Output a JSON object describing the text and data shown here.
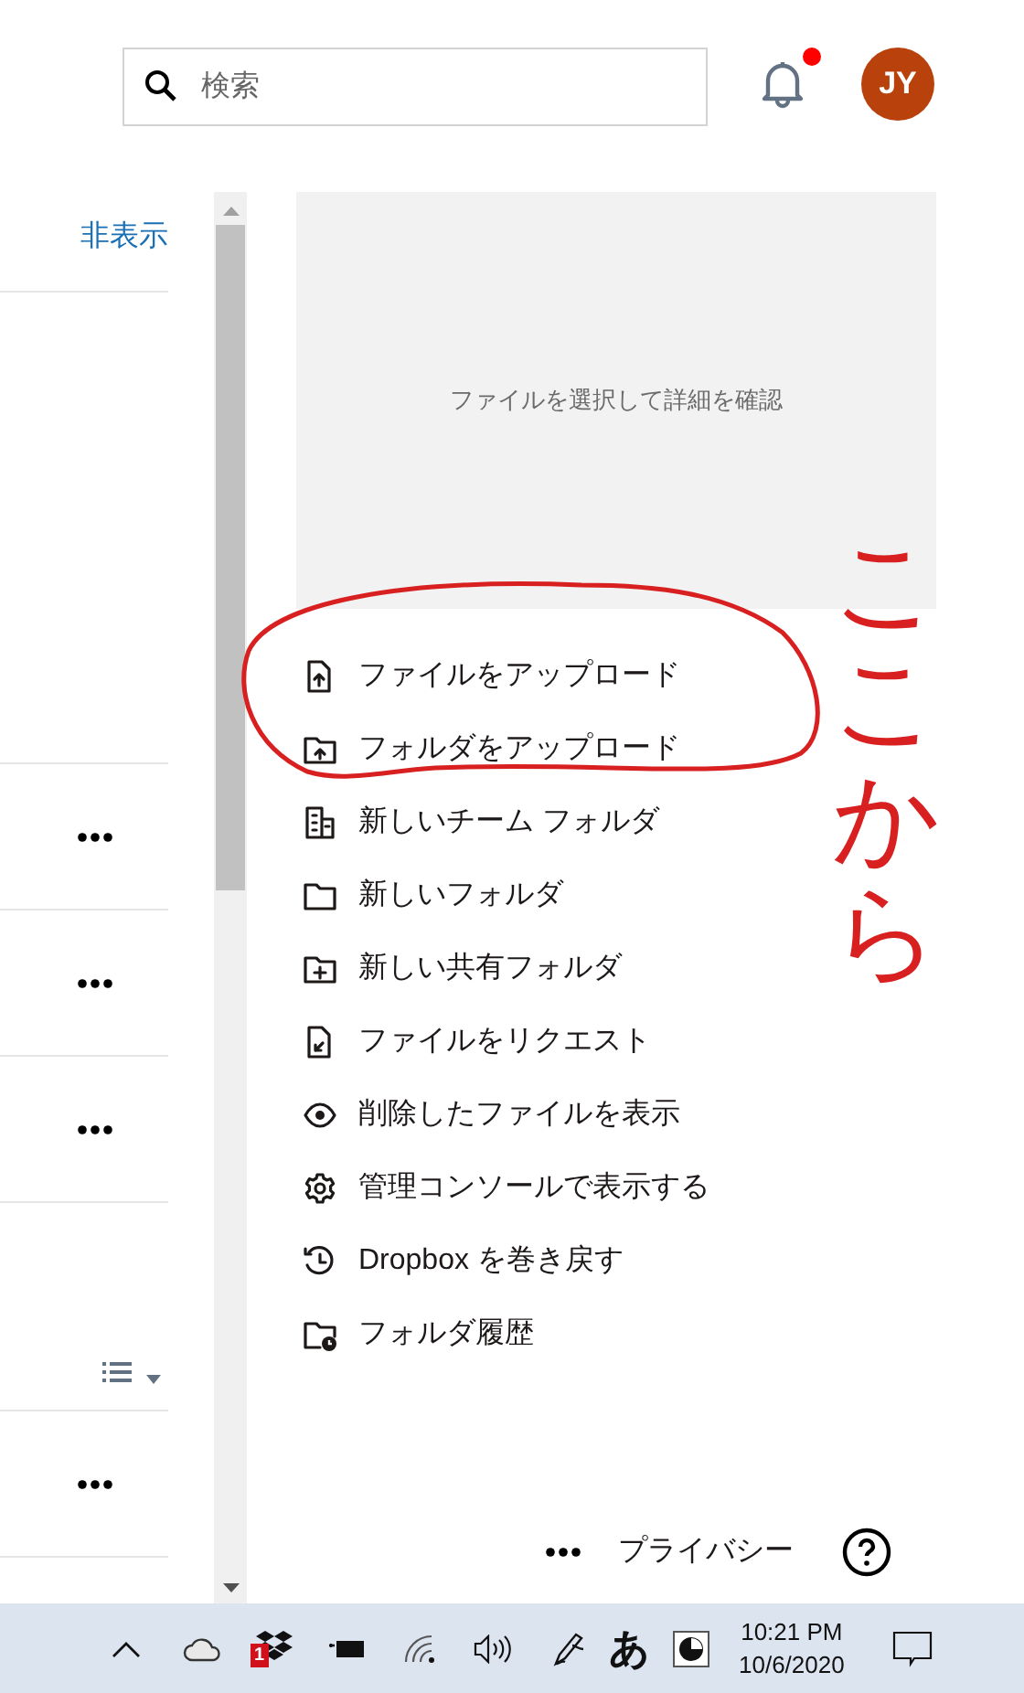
{
  "header": {
    "search": {
      "placeholder": "検索"
    },
    "notifications": {
      "unread": true
    },
    "avatar": {
      "initials": "JY"
    }
  },
  "left_pane": {
    "hide_link": "非表示",
    "rows": [
      {
        "kind": "more"
      },
      {
        "kind": "more"
      },
      {
        "kind": "more"
      },
      {
        "kind": "view"
      },
      {
        "kind": "more"
      }
    ]
  },
  "details": {
    "placeholder": "ファイルを選択して詳細を確認"
  },
  "actions": [
    "ファイルをアップロード",
    "フォルダをアップロード",
    "新しいチーム フォルダ",
    "新しいフォルダ",
    "新しい共有フォルダ",
    "ファイルをリクエスト",
    "削除したファイルを表示",
    "管理コンソールで表示する",
    "Dropbox を巻き戻す",
    "フォルダ履歴"
  ],
  "footer": {
    "privacy": "プライバシー"
  },
  "annotation": {
    "text": "ここから"
  },
  "taskbar": {
    "dropbox_badge": "1",
    "ime": "あ",
    "time": "10:21 PM",
    "date": "10/6/2020"
  }
}
